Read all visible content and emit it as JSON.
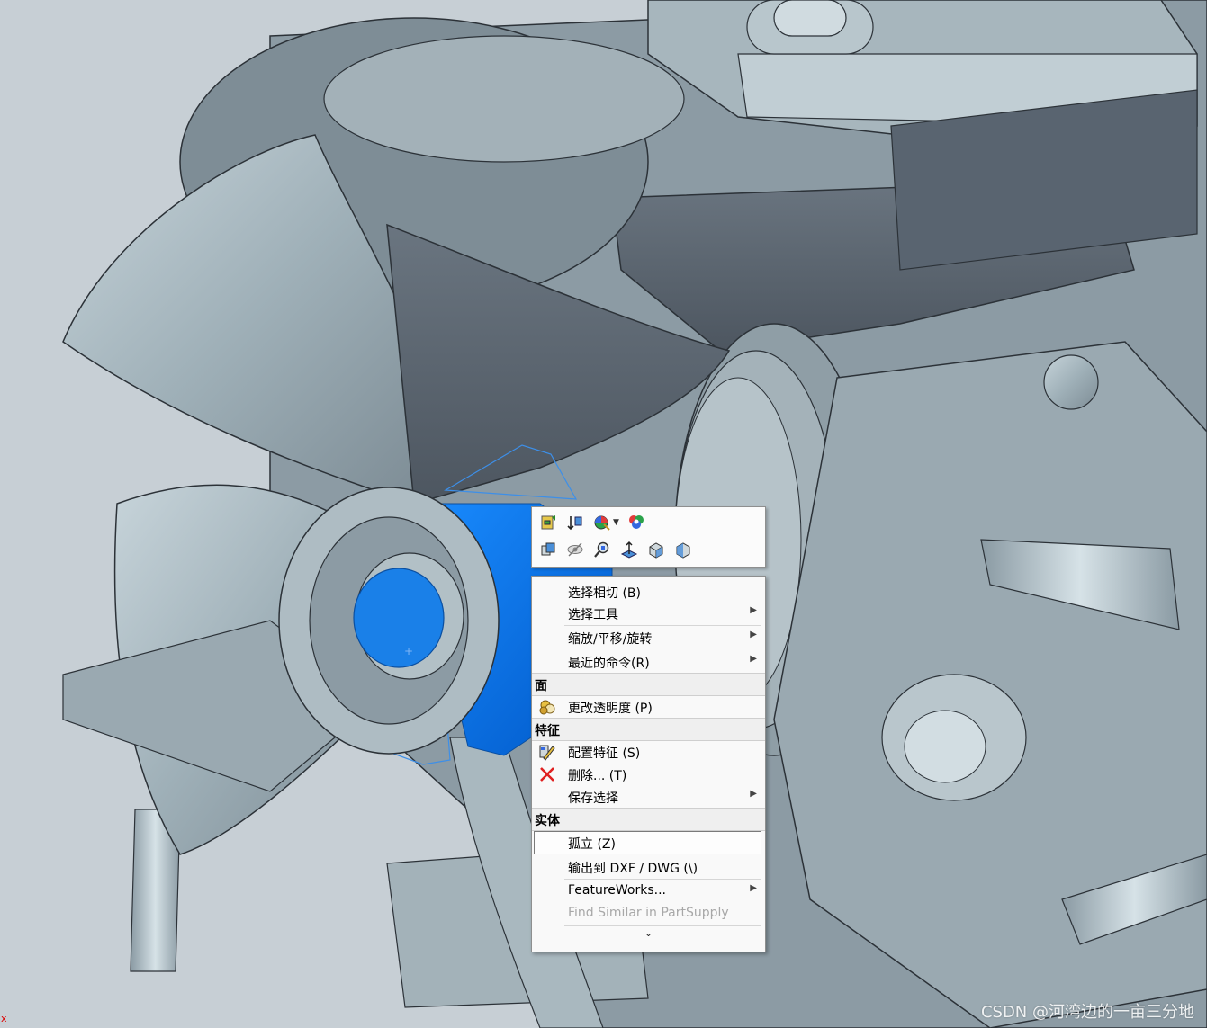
{
  "toolbar": {
    "row1": [
      {
        "icon": "rebuild-icon"
      },
      {
        "icon": "rollback-icon"
      },
      {
        "icon": "appearance-icon",
        "dropdown": true
      },
      {
        "icon": "scene-icon"
      }
    ],
    "row2": [
      {
        "icon": "hide-show-icon"
      },
      {
        "icon": "hide-icon"
      },
      {
        "icon": "zoom-to-selection-icon"
      },
      {
        "icon": "normal-to-icon"
      },
      {
        "icon": "view-orientation-icon"
      },
      {
        "icon": "section-view-icon"
      }
    ]
  },
  "menu": {
    "items_top": [
      {
        "label": "选择相切 (B)",
        "submenu": false
      },
      {
        "label": "选择工具",
        "submenu": true
      },
      {
        "label": "缩放/平移/旋转",
        "submenu": true
      },
      {
        "label": "最近的命令(R)",
        "submenu": true
      }
    ],
    "section_face": "面",
    "face_items": [
      {
        "label": "更改透明度 (P)",
        "icon": "transparency-icon"
      }
    ],
    "section_feature": "特征",
    "feature_items": [
      {
        "label": "配置特征 (S)",
        "icon": "configure-feature-icon",
        "submenu": false
      },
      {
        "label": "删除... (T)",
        "icon": "delete-icon",
        "submenu": false
      },
      {
        "label": "保存选择",
        "submenu": true
      }
    ],
    "section_body": "实体",
    "body_items": [
      {
        "label": "孤立 (Z)",
        "highlighted": true
      },
      {
        "label": "输出到 DXF / DWG (\\)"
      },
      {
        "label": "FeatureWorks...",
        "submenu": true
      },
      {
        "label": "Find Similar in PartSupply",
        "disabled": true
      }
    ],
    "more": "⌄"
  },
  "origin_mark": "x",
  "watermark": "CSDN @河湾边的一亩三分地",
  "colors": {
    "selected_face": "#0a78f0",
    "model_steel": "#a9bac2",
    "model_dark": "#5a6470",
    "background": "#c4ccd2",
    "delete_red": "#e02020"
  }
}
